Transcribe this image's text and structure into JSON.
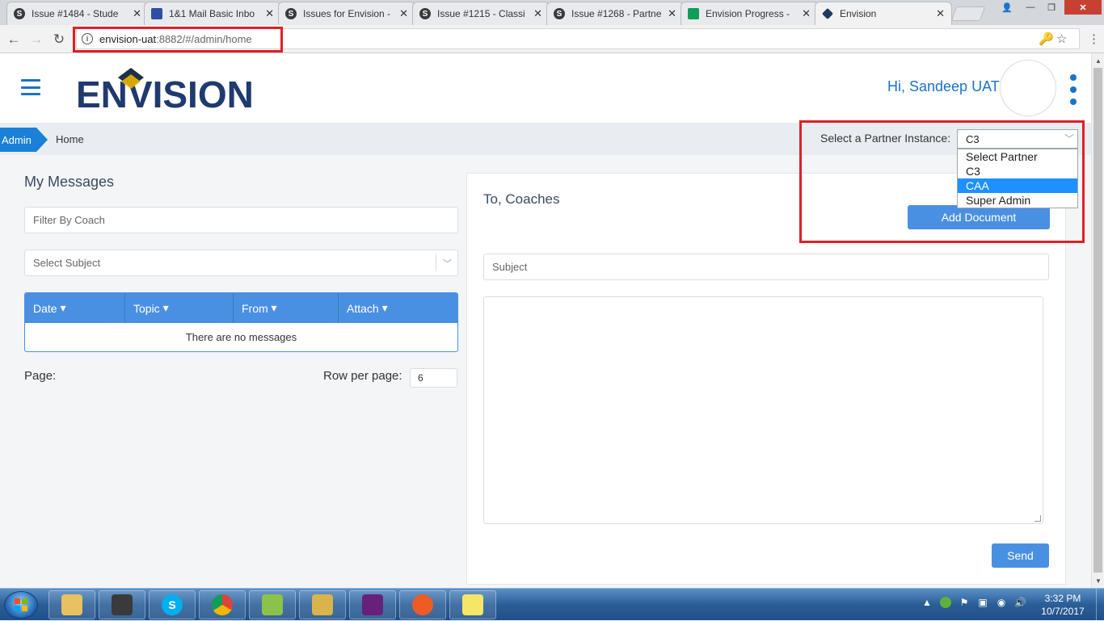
{
  "browser": {
    "tabs": [
      {
        "title": "Issue #1484 - Stude",
        "icon": "s-icon"
      },
      {
        "title": "1&1 Mail Basic Inbo",
        "icon": "mail-icon"
      },
      {
        "title": "Issues for Envision -",
        "icon": "s-icon"
      },
      {
        "title": "Issue #1215 - Classi",
        "icon": "s-icon"
      },
      {
        "title": "Issue #1268 - Partne",
        "icon": "s-icon"
      },
      {
        "title": "Envision Progress -",
        "icon": "sheets-icon"
      },
      {
        "title": "Envision",
        "icon": "envision-icon"
      }
    ],
    "url_host": "envision-uat",
    "url_rest": ":8882/#/admin/home",
    "favicon_letter": "S",
    "close_glyph": "✕",
    "window_controls": {
      "user": "👤",
      "min": "—",
      "max": "❐",
      "close": "✕"
    },
    "nav": {
      "back": "←",
      "forward": "→",
      "reload": "↻",
      "key": "🔑",
      "star": "☆",
      "menu": "⋮"
    }
  },
  "app": {
    "greeting": "Hi, Sandeep UAT",
    "logo_text": "ENVISION"
  },
  "breadcrumb": {
    "root": "Admin",
    "current": "Home"
  },
  "partner": {
    "label": "Select a Partner Instance:",
    "selected": "C3",
    "options": [
      "Select Partner",
      "C3",
      "CAA",
      "Super Admin"
    ],
    "highlighted_index": 2
  },
  "messages": {
    "title": "My Messages",
    "filter_placeholder": "Filter By Coach",
    "subject_placeholder": "Select Subject",
    "columns": [
      "Date",
      "Topic",
      "From",
      "Attach"
    ],
    "empty_text": "There are no messages",
    "page_label": "Page:",
    "rows_per_page_label": "Row per page:",
    "rows_per_page": "6"
  },
  "compose": {
    "to": "To, Coaches",
    "add_document": "Add Document",
    "subject_placeholder": "Subject",
    "send": "Send"
  },
  "taskbar": {
    "time": "3:32 PM",
    "date": "10/7/2017"
  },
  "colors": {
    "brand_blue": "#1a73c8",
    "header_blue": "#4a90e2",
    "highlight_red": "#e01f26",
    "logo_navy": "#1f3a6e"
  }
}
